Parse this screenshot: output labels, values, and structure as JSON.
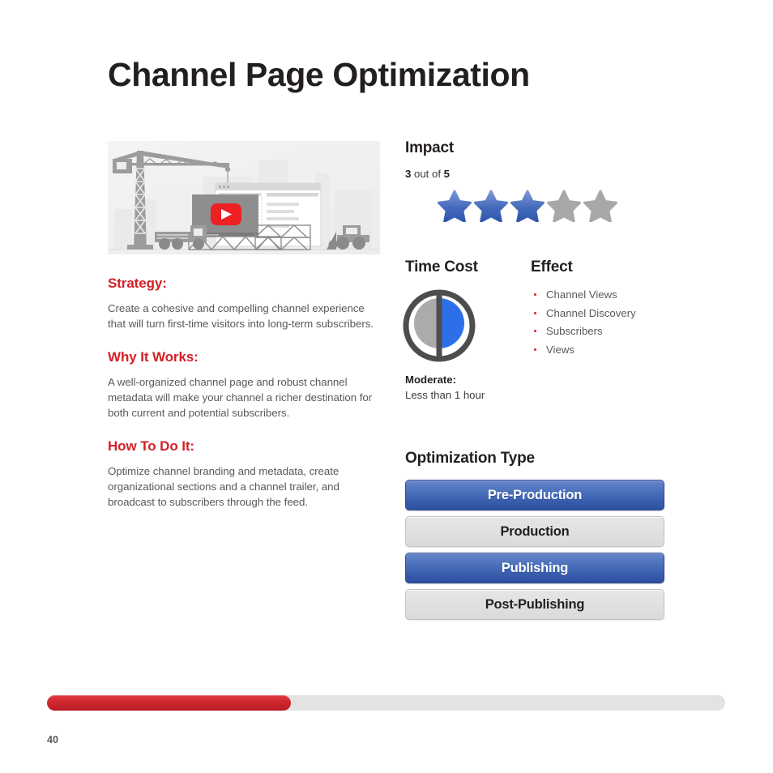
{
  "document": {
    "title": "Channel Page Optimization",
    "page_number": "40",
    "progress_percent": 36,
    "accent_red": "#d42027",
    "accent_blue": "#3a5faf",
    "body_text_color": "#58595b"
  },
  "illustration": {
    "name": "construction-site-illustration",
    "alt": "Construction crane, truck, bulldozer, scaffolding and a browser window with a YouTube play button",
    "play_button_color": "#ed2024"
  },
  "left": {
    "sections": [
      {
        "heading": "Strategy:",
        "body": "Create a cohesive and compelling channel experience that will turn first-time visitors into long-term subscribers."
      },
      {
        "heading": "Why It Works:",
        "body": "A well-organized channel page and robust channel metadata will make your channel a richer destination for both current and potential subscribers."
      },
      {
        "heading": "How To Do It:",
        "body": "Optimize channel branding and metadata, create organizational sections and a channel trailer, and broadcast to subscribers through the feed."
      }
    ]
  },
  "impact": {
    "heading": "Impact",
    "score": "3",
    "out_of_label": " out of ",
    "max": "5",
    "stars_filled": 3,
    "stars_total": 5,
    "star_filled_color": "#3a5faf",
    "star_empty_color": "#a8a8a8"
  },
  "time_cost": {
    "heading": "Time Cost",
    "level": "Moderate:",
    "detail": "Less than 1 hour",
    "gauge_icon": "half-filled-gauge-icon",
    "gauge_fill_color": "#2d6fe8",
    "gauge_empty_color": "#ababab",
    "gauge_ring_color": "#4d4d4d"
  },
  "effect": {
    "heading": "Effect",
    "items": [
      "Channel Views",
      "Channel Discovery",
      "Subscribers",
      "Views"
    ]
  },
  "optimization_type": {
    "heading": "Optimization Type",
    "options": [
      {
        "label": "Pre-Production",
        "active": true
      },
      {
        "label": "Production",
        "active": false
      },
      {
        "label": "Publishing",
        "active": true
      },
      {
        "label": "Post-Publishing",
        "active": false
      }
    ]
  }
}
